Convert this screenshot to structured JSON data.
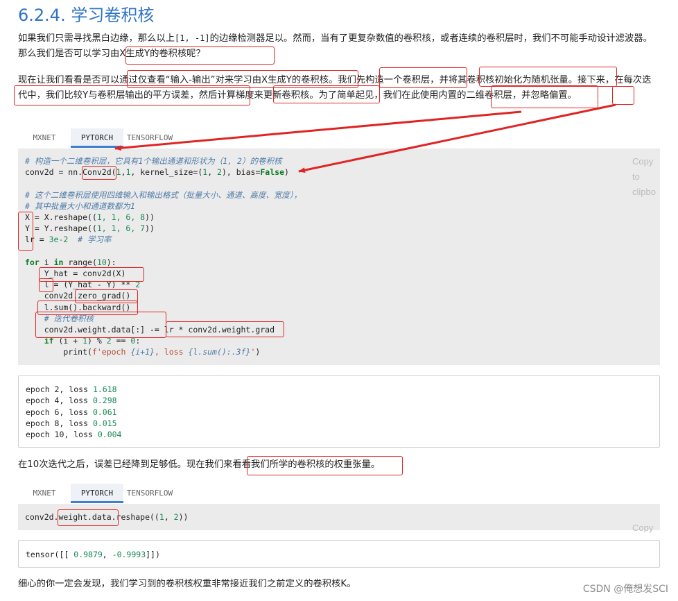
{
  "section_title": "6.2.4. 学习卷积核",
  "para1": {
    "t1": "如果我们只需寻找黑白边缘，那么以上",
    "code": "[1, -1]",
    "t2": "的边缘检测器足以。然而，当有了更复杂数值的卷积核，或者连续的卷积层时，我们不可能手动设计滤波器。那么我们是否可以学习由X生成Y的卷积核呢？"
  },
  "para2": "现在让我们看看是否可以通过仅查看“输入-输出”对来学习由X生成Y的卷积核。我们先构造一个卷积层，并将其卷积核初始化为随机张量。接下来，在每次迭代中，我们比较Y与卷积层输出的平方误差，然后计算梯度来更新卷积核。为了简单起见，我们在此使用内置的二维卷积层，并忽略偏置。",
  "tabs1": [
    "MXNET",
    "PYTORCH",
    "TENSORFLOW"
  ],
  "tabs2": [
    "MXNET",
    "PYTORCH",
    "TENSORFLOW"
  ],
  "copy_label1": "Copy to clipbo",
  "copy_label2": "Copy",
  "code1": {
    "l1": "# 构造一个二维卷积层，它具有1个输出通道和形状为（1, 2）的卷积核",
    "l2a": "conv2d = nn.",
    "l2b": "Conv2d",
    "l2c": "(",
    "l2d": "1",
    "l2e": ",",
    "l2f": "1",
    "l2g": ", kernel_size=(",
    "l2h": "1",
    "l2i": ", ",
    "l2j": "2",
    "l2k": "), bias=",
    "l2l": "False",
    "l2m": ")",
    "l3": "# 这个二维卷积层使用四维输入和输出格式（批量大小、通道、高度、宽度），",
    "l4": "# 其中批量大小和通道数都为1",
    "l5a": "X = X.reshape((",
    "l5b": "1, 1, 6, 8",
    "l5c": "))",
    "l6a": "Y = Y.reshape((",
    "l6b": "1, 1, 6, 7",
    "l6c": "))",
    "l7a": "lr = ",
    "l7b": "3e-2",
    "l7c": "  # 学习率",
    "l8a": "for",
    "l8b": " i ",
    "l8c": "in",
    "l8d": " range(",
    "l8e": "10",
    "l8f": "):",
    "l9": "    Y_hat = conv2d(X)",
    "l10a": "    l = (Y_hat - Y) ** ",
    "l10b": "2",
    "l11": "    conv2d.zero_grad()",
    "l12": "    l.sum().backward()",
    "l13": "    # 迭代卷积核",
    "l14": "    conv2d.weight.data[:] -= lr * conv2d.weight.grad",
    "l15a": "    if",
    "l15b": " (i + ",
    "l15c": "1",
    "l15d": ") % ",
    "l15e": "2",
    "l15f": " == ",
    "l15g": "0",
    "l15h": ":",
    "l16a": "        print(",
    "l16b": "f'epoch ",
    "l16c": "{i+1}",
    "l16d": ", loss ",
    "l16e": "{l.sum():.3f}",
    "l16f": "'",
    "l16g": ")"
  },
  "output1": [
    {
      "a": "epoch 2, loss ",
      "b": "1.618"
    },
    {
      "a": "epoch 4, loss ",
      "b": "0.298"
    },
    {
      "a": "epoch 6, loss ",
      "b": "0.061"
    },
    {
      "a": "epoch 8, loss ",
      "b": "0.015"
    },
    {
      "a": "epoch 10, loss ",
      "b": "0.004"
    }
  ],
  "para3": "在10次迭代之后，误差已经降到足够低。现在我们来看看我们所学的卷积核的权重张量。",
  "code2": {
    "a": "conv2d.weight.data.reshape((",
    "b": "1",
    "c": ", ",
    "d": "2",
    "e": "))"
  },
  "output2": {
    "a": "tensor([[ ",
    "b": "0.9879",
    "c": ", ",
    "d": "-0.9993",
    "e": "]])"
  },
  "para4": "细心的你一定会发现，我们学习到的卷积核权重非常接近我们之前定义的卷积核K。",
  "watermark": "CSDN @俺想发SCI",
  "annotation_color": "#e02424"
}
